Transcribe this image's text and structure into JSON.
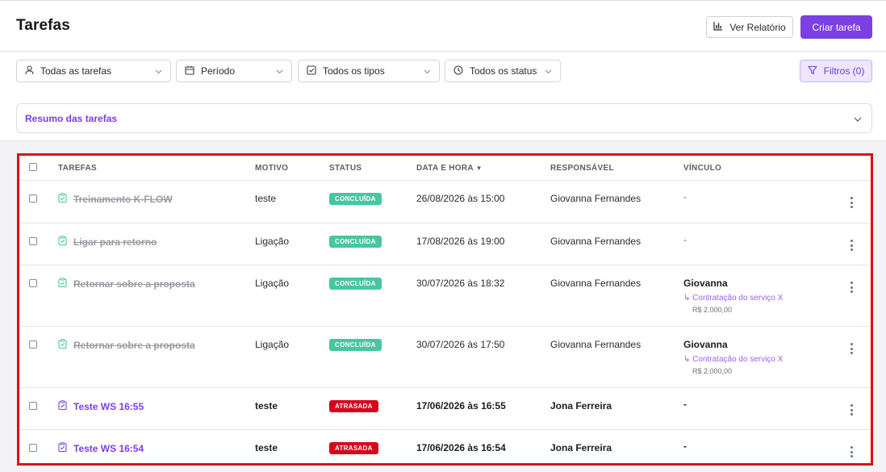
{
  "header": {
    "title": "Tarefas",
    "report_button": "Ver Relatório",
    "create_button": "Criar tarefa"
  },
  "filters": {
    "assignee": "Todas as tarefas",
    "period": "Período",
    "type": "Todos os tipos",
    "status": "Todos os status",
    "filters_button": "Filtros (0)"
  },
  "summary": {
    "label": "Resumo das tarefas"
  },
  "table": {
    "columns": {
      "tasks": "TAREFAS",
      "reason": "MOTIVO",
      "status": "STATUS",
      "datetime": "DATA E HORA",
      "datetime_sort": "▼",
      "owner": "RESPONSÁVEL",
      "link": "VÍNCULO"
    },
    "rows": [
      {
        "task": "Treinamento K-FLOW",
        "reason": "teste",
        "status": "CONCLUÍDA",
        "datetime": "26/08/2026 às 15:00",
        "owner": "Giovanna Fernandes",
        "link": "-"
      },
      {
        "task": "Ligar para retorno",
        "reason": "Ligação",
        "status": "CONCLUÍDA",
        "datetime": "17/08/2026 às 19:00",
        "owner": "Giovanna Fernandes",
        "link": "-"
      },
      {
        "task": "Retornar sobre a proposta",
        "reason": "Ligação",
        "status": "CONCLUÍDA",
        "datetime": "30/07/2026 às 18:32",
        "owner": "Giovanna Fernandes",
        "link": "Giovanna",
        "link_sub": "↳ Contratação do serviço X",
        "link_value": "R$ 2.000,00"
      },
      {
        "task": "Retornar sobre a proposta",
        "reason": "Ligação",
        "status": "CONCLUÍDA",
        "datetime": "30/07/2026 às 17:50",
        "owner": "Giovanna Fernandes",
        "link": "Giovanna",
        "link_sub": "↳ Contratação do serviço X",
        "link_value": "R$ 2.000,00"
      },
      {
        "task": "Teste WS 16:55",
        "reason": "teste",
        "status": "ATRASADA",
        "datetime": "17/06/2026 às 16:55",
        "owner": "Jona Ferreira",
        "link": "-"
      },
      {
        "task": "Teste WS 16:54",
        "reason": "teste",
        "status": "ATRASADA",
        "datetime": "17/06/2026 às 16:54",
        "owner": "Jona Ferreira",
        "link": "-"
      }
    ]
  },
  "colors": {
    "accent": "#7b3fe4",
    "done_badge": "#46c7a0",
    "late_badge": "#d9001b",
    "highlight_border": "#e00b1c"
  },
  "icons": {
    "report": "bar-chart-icon",
    "user_filter": "user-icon",
    "period_filter": "calendar-icon",
    "type_filter": "checkbox-square-icon",
    "status_filter": "clock-icon",
    "filters": "funnel-icon",
    "task_done": "clipboard-check-icon",
    "task_late": "clipboard-check-icon",
    "row_menu": "kebab-menu-icon"
  }
}
